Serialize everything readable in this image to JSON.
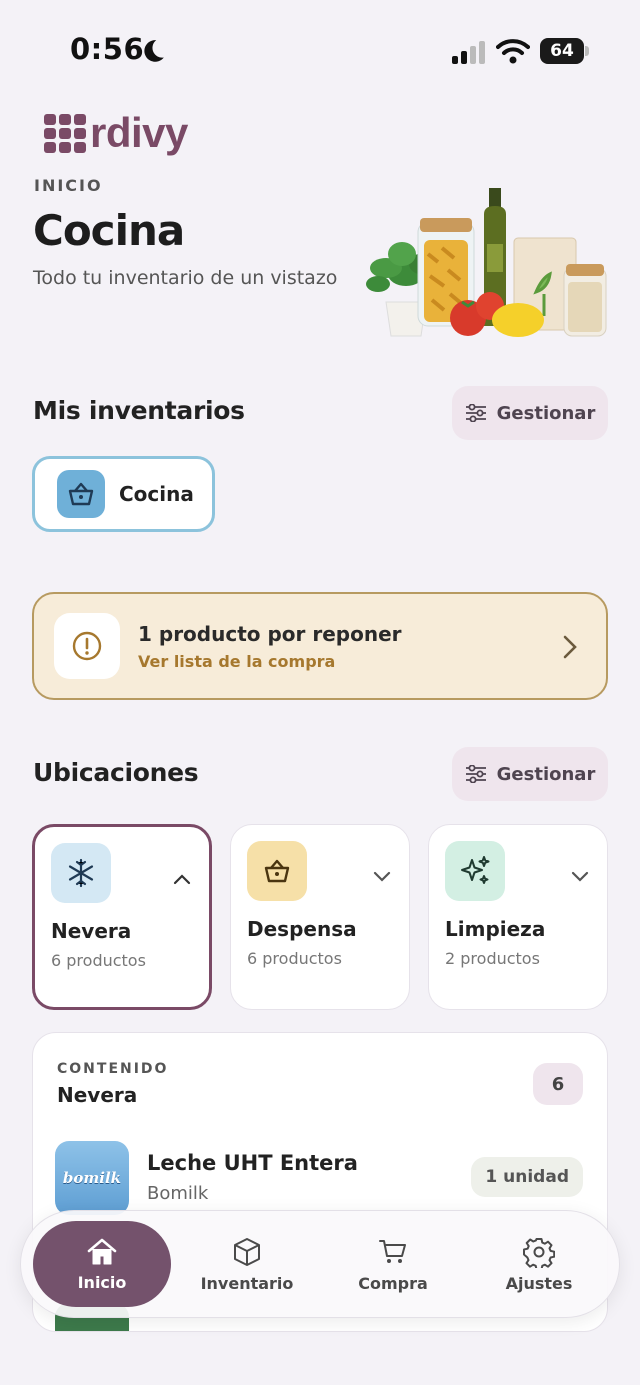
{
  "status": {
    "time": "0:56",
    "battery": "64"
  },
  "app": {
    "logo": "rdivy"
  },
  "header": {
    "overline": "INICIO",
    "title": "Cocina",
    "subtitle": "Todo tu inventario de un vistazo"
  },
  "inventories": {
    "title": "Mis inventarios",
    "manage_label": "Gestionar",
    "items": [
      {
        "label": "Cocina",
        "icon": "basket-icon"
      }
    ]
  },
  "alert": {
    "title": "1 producto por reponer",
    "link": "Ver lista de la compra"
  },
  "locations": {
    "title": "Ubicaciones",
    "manage_label": "Gestionar",
    "items": [
      {
        "name": "Nevera",
        "count": "6 productos",
        "icon": "snowflake-icon",
        "selected": true
      },
      {
        "name": "Despensa",
        "count": "6 productos",
        "icon": "basket-icon",
        "selected": false
      },
      {
        "name": "Limpieza",
        "count": "2 productos",
        "icon": "sparkles-icon",
        "selected": false
      }
    ]
  },
  "content": {
    "overline": "CONTENIDO",
    "title": "Nevera",
    "count": "6",
    "products": [
      {
        "name": "Leche UHT Entera",
        "brand": "Bomilk",
        "qty": "1 unidad",
        "image_label": "bomilk"
      }
    ]
  },
  "tabs": [
    {
      "label": "Inicio",
      "icon": "home-icon",
      "active": true
    },
    {
      "label": "Inventario",
      "icon": "box-icon",
      "active": false
    },
    {
      "label": "Compra",
      "icon": "cart-icon",
      "active": false
    },
    {
      "label": "Ajustes",
      "icon": "gear-icon",
      "active": false
    }
  ],
  "colors": {
    "accent": "#74526c",
    "background": "#f4f2f7",
    "alert_bg": "#f7ecd9",
    "alert_link": "#a6782e"
  }
}
